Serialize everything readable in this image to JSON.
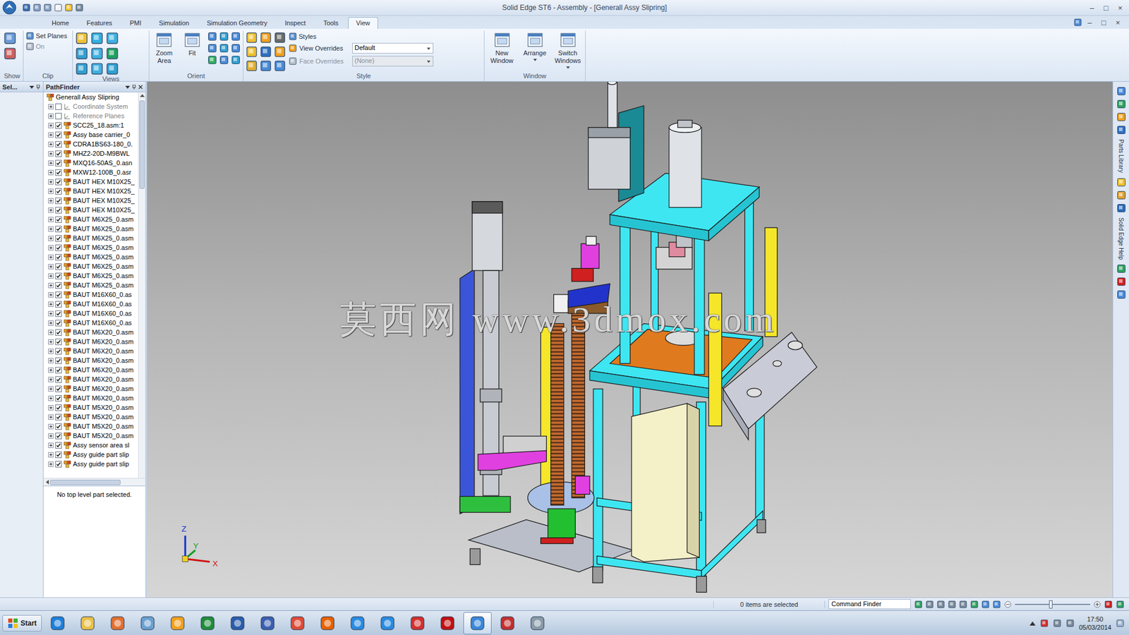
{
  "window": {
    "title": "Solid Edge ST6 - Assembly - [Generall Assy Slipring]",
    "controls": [
      "–",
      "□",
      "×"
    ],
    "doc_controls": [
      "–",
      "□",
      "×"
    ]
  },
  "tabs": [
    {
      "label": "Home",
      "selected": false
    },
    {
      "label": "Features",
      "selected": false
    },
    {
      "label": "PMI",
      "selected": false
    },
    {
      "label": "Simulation",
      "selected": false
    },
    {
      "label": "Simulation Geometry",
      "selected": false
    },
    {
      "label": "Inspect",
      "selected": false
    },
    {
      "label": "Tools",
      "selected": false
    },
    {
      "label": "View",
      "selected": true
    }
  ],
  "ribbon": {
    "groups": [
      {
        "kind": "show",
        "label": "Show"
      },
      {
        "kind": "clip",
        "label": "Clip",
        "items": [
          {
            "label": "Set Planes",
            "disabled": false
          },
          {
            "label": "On",
            "disabled": true
          }
        ]
      },
      {
        "kind": "views",
        "label": "Views"
      },
      {
        "kind": "orient",
        "label": "Orient",
        "buttons": [
          "Zoom Area",
          "Fit"
        ]
      },
      {
        "kind": "style",
        "label": "Style",
        "styles": "Styles",
        "fields": [
          {
            "label": "View Overrides",
            "value": "Default",
            "disabled": false
          },
          {
            "label": "Face Overrides",
            "value": "(None)",
            "disabled": true
          }
        ]
      },
      {
        "kind": "window",
        "label": "Window",
        "buttons": [
          {
            "label": "New Window",
            "dropdown": false
          },
          {
            "label": "Arrange",
            "dropdown": true
          },
          {
            "label": "Switch Windows",
            "dropdown": true
          }
        ]
      }
    ]
  },
  "select_panel": {
    "title": "Sel..."
  },
  "pathfinder": {
    "title": "PathFinder",
    "footer": "No top level part selected.",
    "items": [
      {
        "label": "Generall Assy Slipring",
        "kind": "root",
        "checked": false,
        "dimmed": false,
        "expanded": true
      },
      {
        "label": "Coordinate System",
        "kind": "reference",
        "checked": false,
        "dimmed": true,
        "expanded": false
      },
      {
        "label": "Reference Planes",
        "kind": "reference",
        "checked": false,
        "dimmed": true,
        "expanded": false
      },
      {
        "label": "SCC25_18.asm:1",
        "kind": "part",
        "checked": true,
        "dimmed": false,
        "expanded": false
      },
      {
        "label": "Assy base carrier_0",
        "kind": "part",
        "checked": true,
        "dimmed": false,
        "expanded": false
      },
      {
        "label": "CDRA1BS63-180_0.",
        "kind": "part",
        "checked": true,
        "dimmed": false,
        "expanded": false
      },
      {
        "label": "MHZ2-20D-M9BWL",
        "kind": "part",
        "checked": true,
        "dimmed": false,
        "expanded": false
      },
      {
        "label": "MXQ16-50AS_0.asn",
        "kind": "part",
        "checked": true,
        "dimmed": false,
        "expanded": false
      },
      {
        "label": "MXW12-100B_0.asr",
        "kind": "part",
        "checked": true,
        "dimmed": false,
        "expanded": false
      },
      {
        "label": "BAUT HEX M10X25_",
        "kind": "part",
        "checked": true,
        "dimmed": false,
        "expanded": false
      },
      {
        "label": "BAUT HEX M10X25_",
        "kind": "part",
        "checked": true,
        "dimmed": false,
        "expanded": false
      },
      {
        "label": "BAUT HEX M10X25_",
        "kind": "part",
        "checked": true,
        "dimmed": false,
        "expanded": false
      },
      {
        "label": "BAUT HEX M10X25_",
        "kind": "part",
        "checked": true,
        "dimmed": false,
        "expanded": false
      },
      {
        "label": "BAUT M6X25_0.asm",
        "kind": "part",
        "checked": true,
        "dimmed": false,
        "expanded": false
      },
      {
        "label": "BAUT M6X25_0.asm",
        "kind": "part",
        "checked": true,
        "dimmed": false,
        "expanded": false
      },
      {
        "label": "BAUT M6X25_0.asm",
        "kind": "part",
        "checked": true,
        "dimmed": false,
        "expanded": false
      },
      {
        "label": "BAUT M6X25_0.asm",
        "kind": "part",
        "checked": true,
        "dimmed": false,
        "expanded": false
      },
      {
        "label": "BAUT M6X25_0.asm",
        "kind": "part",
        "checked": true,
        "dimmed": false,
        "expanded": false
      },
      {
        "label": "BAUT M6X25_0.asm",
        "kind": "part",
        "checked": true,
        "dimmed": false,
        "expanded": false
      },
      {
        "label": "BAUT M6X25_0.asm",
        "kind": "part",
        "checked": true,
        "dimmed": false,
        "expanded": false
      },
      {
        "label": "BAUT M6X25_0.asm",
        "kind": "part",
        "checked": true,
        "dimmed": false,
        "expanded": false
      },
      {
        "label": "BAUT M16X60_0.as",
        "kind": "part",
        "checked": true,
        "dimmed": false,
        "expanded": false
      },
      {
        "label": "BAUT M16X60_0.as",
        "kind": "part",
        "checked": true,
        "dimmed": false,
        "expanded": false
      },
      {
        "label": "BAUT M16X60_0.as",
        "kind": "part",
        "checked": true,
        "dimmed": false,
        "expanded": false
      },
      {
        "label": "BAUT M16X60_0.as",
        "kind": "part",
        "checked": true,
        "dimmed": false,
        "expanded": false
      },
      {
        "label": "BAUT M6X20_0.asm",
        "kind": "part",
        "checked": true,
        "dimmed": false,
        "expanded": false
      },
      {
        "label": "BAUT M6X20_0.asm",
        "kind": "part",
        "checked": true,
        "dimmed": false,
        "expanded": false
      },
      {
        "label": "BAUT M6X20_0.asm",
        "kind": "part",
        "checked": true,
        "dimmed": false,
        "expanded": false
      },
      {
        "label": "BAUT M6X20_0.asm",
        "kind": "part",
        "checked": true,
        "dimmed": false,
        "expanded": false
      },
      {
        "label": "BAUT M6X20_0.asm",
        "kind": "part",
        "checked": true,
        "dimmed": false,
        "expanded": false
      },
      {
        "label": "BAUT M6X20_0.asm",
        "kind": "part",
        "checked": true,
        "dimmed": false,
        "expanded": false
      },
      {
        "label": "BAUT M6X20_0.asm",
        "kind": "part",
        "checked": true,
        "dimmed": false,
        "expanded": false
      },
      {
        "label": "BAUT M6X20_0.asm",
        "kind": "part",
        "checked": true,
        "dimmed": false,
        "expanded": false
      },
      {
        "label": "BAUT M5X20_0.asm",
        "kind": "part",
        "checked": true,
        "dimmed": false,
        "expanded": false
      },
      {
        "label": "BAUT M5X20_0.asm",
        "kind": "part",
        "checked": true,
        "dimmed": false,
        "expanded": false
      },
      {
        "label": "BAUT M5X20_0.asm",
        "kind": "part",
        "checked": true,
        "dimmed": false,
        "expanded": false
      },
      {
        "label": "BAUT M5X20_0.asm",
        "kind": "part",
        "checked": true,
        "dimmed": false,
        "expanded": false
      },
      {
        "label": "Assy sensor area sl",
        "kind": "part",
        "checked": true,
        "dimmed": false,
        "expanded": false
      },
      {
        "label": "Assy guide part slip",
        "kind": "part",
        "checked": true,
        "dimmed": false,
        "expanded": false
      },
      {
        "label": "Assy guide part slip",
        "kind": "part",
        "checked": true,
        "dimmed": false,
        "expanded": false
      }
    ]
  },
  "viewport": {
    "watermark": "莫西网 www.3dmox.com",
    "axes": [
      "Z",
      "Y",
      "X"
    ]
  },
  "right_strip": {
    "labels": [
      "Parts Library",
      "Solid Edge Help"
    ]
  },
  "status_bar": {
    "selection": "0 items are selected",
    "command_finder": "Command Finder",
    "zoom": {
      "level": 0.48
    }
  },
  "taskbar": {
    "start": "Start",
    "time": "17:50",
    "date": "05/03/2014",
    "apps": [
      {
        "color": "#1e7fd8",
        "selected": false
      },
      {
        "color": "#e8c14a",
        "selected": false
      },
      {
        "color": "#e07030",
        "selected": false
      },
      {
        "color": "#6aa0d0",
        "selected": false
      },
      {
        "color": "#f0a020",
        "selected": false
      },
      {
        "color": "#1f8c3b",
        "selected": false
      },
      {
        "color": "#2a5caa",
        "selected": false
      },
      {
        "color": "#3a5fb0",
        "selected": false
      },
      {
        "color": "#dd4b39",
        "selected": false
      },
      {
        "color": "#e66000",
        "selected": false
      },
      {
        "color": "#2a8ae0",
        "selected": false
      },
      {
        "color": "#2a8ae0",
        "selected": false
      },
      {
        "color": "#d03030",
        "selected": false
      },
      {
        "color": "#c01010",
        "selected": false
      },
      {
        "color": "#3a88d8",
        "selected": true
      },
      {
        "color": "#c03030",
        "selected": false
      },
      {
        "color": "#8a9aa8",
        "selected": false
      }
    ]
  }
}
